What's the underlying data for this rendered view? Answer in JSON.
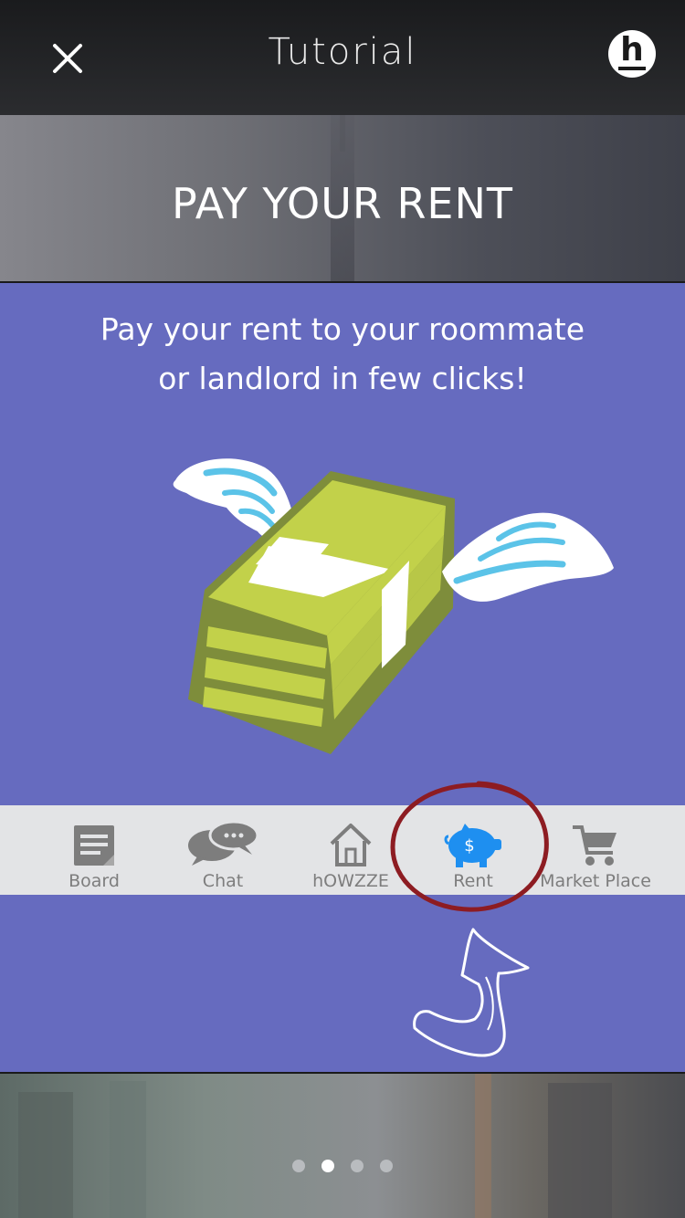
{
  "nav": {
    "title": "Tutorial",
    "close_icon": "close-icon",
    "logo_letter": "h"
  },
  "banner": {
    "title": "PAY YOUR RENT"
  },
  "panel": {
    "subtitle_line1": "Pay your rent to your roommate",
    "subtitle_line2": "or landlord in few clicks!",
    "illustration": "flying-money-stack"
  },
  "tabbar": {
    "tabs": [
      {
        "label": "Board",
        "icon": "board-icon"
      },
      {
        "label": "Chat",
        "icon": "chat-icon"
      },
      {
        "label": "hOWZZE",
        "icon": "home-icon"
      },
      {
        "label": "Rent",
        "icon": "piggy-bank-icon"
      },
      {
        "label": "Market Place",
        "icon": "cart-icon"
      }
    ],
    "active_index": 3,
    "active_color": "#1e8ff0",
    "inactive_color": "#7d7d7d"
  },
  "pager": {
    "count": 4,
    "active_index": 1
  },
  "colors": {
    "panel_bg": "#666bbf",
    "annotation_circle": "#8d1c22"
  }
}
